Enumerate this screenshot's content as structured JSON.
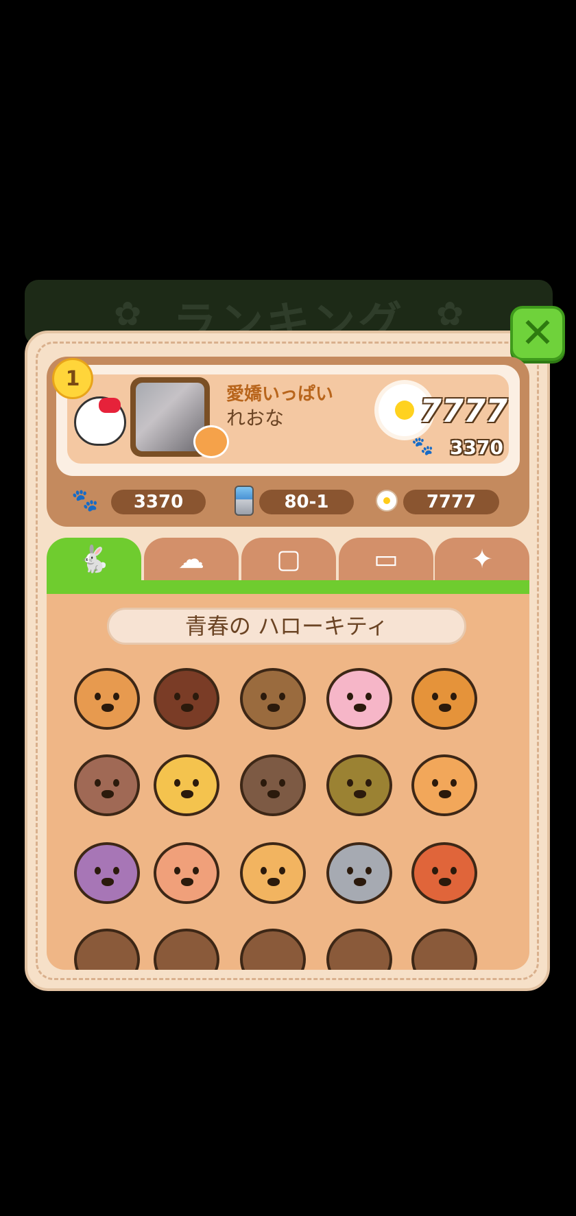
{
  "header": {
    "title": "ランキング",
    "deco_icon": "flower-star-icon"
  },
  "close_button": {
    "icon": "close-x-icon",
    "color": "#6fd23b"
  },
  "profile": {
    "rank": "1",
    "character_icon": "hello-kitty-icon",
    "avatar_icon": "user-photo",
    "pet_icon": "cat-icon",
    "nickname": "愛嬌いっぱい",
    "username": "れおな",
    "flower_score": "7777",
    "paw_score": "3370"
  },
  "stats": {
    "paw": {
      "icon": "paw-icon",
      "value": "3370"
    },
    "stage": {
      "icon": "gem-tower-icon",
      "value": "80-1"
    },
    "flower": {
      "icon": "flower-icon",
      "value": "7777"
    }
  },
  "tabs": [
    {
      "icon": "rabbit-icon",
      "active": true
    },
    {
      "icon": "watering-can-icon",
      "active": false
    },
    {
      "icon": "square-frame-icon",
      "active": false
    },
    {
      "icon": "wide-frame-icon",
      "active": false
    },
    {
      "icon": "sparkle-icon",
      "active": false
    }
  ],
  "collection": {
    "theme_label": "青春の ハローキティ",
    "animals": [
      {
        "name": "shiba-icon",
        "color": "#e79a4f"
      },
      {
        "name": "monkey-icon",
        "color": "#7a3c26"
      },
      {
        "name": "raccoon-icon",
        "color": "#9a6b3e"
      },
      {
        "name": "sheep-icon",
        "color": "#f6b6c8"
      },
      {
        "name": "lion-icon",
        "color": "#e5933a"
      },
      {
        "name": "beaver-icon",
        "color": "#a06955"
      },
      {
        "name": "tabby-cat-icon",
        "color": "#f4c34e"
      },
      {
        "name": "dog-icon",
        "color": "#7d5a44"
      },
      {
        "name": "deer-icon",
        "color": "#9b8233"
      },
      {
        "name": "kangaroo-icon",
        "color": "#f2a75a"
      },
      {
        "name": "boar-icon",
        "color": "#a776b6"
      },
      {
        "name": "zebra-icon",
        "color": "#f0a07a"
      },
      {
        "name": "cheetah-icon",
        "color": "#f2b460"
      },
      {
        "name": "rhino-icon",
        "color": "#a6aab2"
      },
      {
        "name": "tiger-icon",
        "color": "#e0653a"
      }
    ]
  }
}
